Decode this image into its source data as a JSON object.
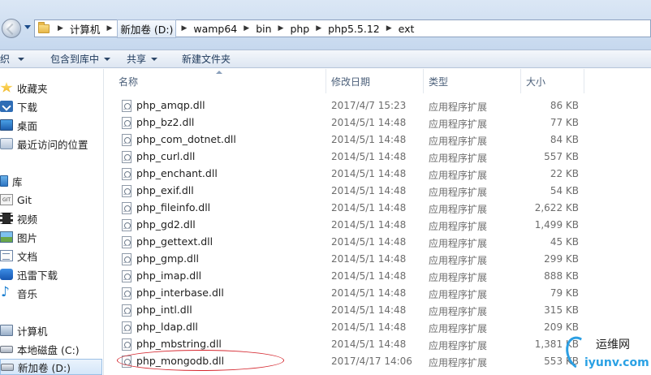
{
  "address_bar": {
    "path": [
      "计算机",
      "新加卷 (D:)",
      "wamp64",
      "bin",
      "php",
      "php5.5.12",
      "ext"
    ]
  },
  "toolbar": {
    "items": [
      {
        "label": "织",
        "has_arrow": true
      },
      {
        "label": "包含到库中",
        "has_arrow": true
      },
      {
        "label": "共享",
        "has_arrow": true
      },
      {
        "label": "新建文件夹",
        "has_arrow": false
      }
    ]
  },
  "nav_pane": {
    "items": [
      {
        "label": "收藏夹",
        "icon": "star-icon"
      },
      {
        "label": "下载",
        "icon": "download-icon"
      },
      {
        "label": "桌面",
        "icon": "desktop-icon"
      },
      {
        "label": "最近访问的位置",
        "icon": "recent-places-icon"
      },
      {
        "label": "库",
        "icon": "library-icon"
      },
      {
        "label": "Git",
        "icon": "git-icon"
      },
      {
        "label": "视频",
        "icon": "video-icon"
      },
      {
        "label": "图片",
        "icon": "pictures-icon"
      },
      {
        "label": "文档",
        "icon": "documents-icon"
      },
      {
        "label": "迅雷下载",
        "icon": "xunlei-icon"
      },
      {
        "label": "音乐",
        "icon": "music-icon"
      },
      {
        "label": "计算机",
        "icon": "computer-icon"
      },
      {
        "label": "本地磁盘 (C:)",
        "icon": "drive-icon"
      },
      {
        "label": "新加卷 (D:)",
        "icon": "drive-icon",
        "selected": true
      }
    ]
  },
  "file_list": {
    "columns": {
      "name": "名称",
      "modified": "修改日期",
      "type": "类型",
      "size": "大小"
    },
    "files": [
      {
        "name": "php_amqp.dll",
        "modified": "2017/4/7 15:23",
        "type": "应用程序扩展",
        "size": "86 KB"
      },
      {
        "name": "php_bz2.dll",
        "modified": "2014/5/1 14:48",
        "type": "应用程序扩展",
        "size": "77 KB"
      },
      {
        "name": "php_com_dotnet.dll",
        "modified": "2014/5/1 14:48",
        "type": "应用程序扩展",
        "size": "84 KB"
      },
      {
        "name": "php_curl.dll",
        "modified": "2014/5/1 14:48",
        "type": "应用程序扩展",
        "size": "557 KB"
      },
      {
        "name": "php_enchant.dll",
        "modified": "2014/5/1 14:48",
        "type": "应用程序扩展",
        "size": "22 KB"
      },
      {
        "name": "php_exif.dll",
        "modified": "2014/5/1 14:48",
        "type": "应用程序扩展",
        "size": "54 KB"
      },
      {
        "name": "php_fileinfo.dll",
        "modified": "2014/5/1 14:48",
        "type": "应用程序扩展",
        "size": "2,622 KB"
      },
      {
        "name": "php_gd2.dll",
        "modified": "2014/5/1 14:48",
        "type": "应用程序扩展",
        "size": "1,499 KB"
      },
      {
        "name": "php_gettext.dll",
        "modified": "2014/5/1 14:48",
        "type": "应用程序扩展",
        "size": "45 KB"
      },
      {
        "name": "php_gmp.dll",
        "modified": "2014/5/1 14:48",
        "type": "应用程序扩展",
        "size": "299 KB"
      },
      {
        "name": "php_imap.dll",
        "modified": "2014/5/1 14:48",
        "type": "应用程序扩展",
        "size": "888 KB"
      },
      {
        "name": "php_interbase.dll",
        "modified": "2014/5/1 14:48",
        "type": "应用程序扩展",
        "size": "79 KB"
      },
      {
        "name": "php_intl.dll",
        "modified": "2014/5/1 14:48",
        "type": "应用程序扩展",
        "size": "315 KB"
      },
      {
        "name": "php_ldap.dll",
        "modified": "2014/5/1 14:48",
        "type": "应用程序扩展",
        "size": "209 KB"
      },
      {
        "name": "php_mbstring.dll",
        "modified": "2014/5/1 14:48",
        "type": "应用程序扩展",
        "size": "1,381 KB"
      },
      {
        "name": "php_mongodb.dll",
        "modified": "2017/4/17 14:06",
        "type": "应用程序扩展",
        "size": "553 KB",
        "highlighted": true
      }
    ]
  },
  "watermark": {
    "line1": "运维网",
    "line2": "iyunv.com"
  },
  "colors": {
    "annotation_circle": "#d5262e",
    "watermark_blue": "#2aa1e4"
  }
}
